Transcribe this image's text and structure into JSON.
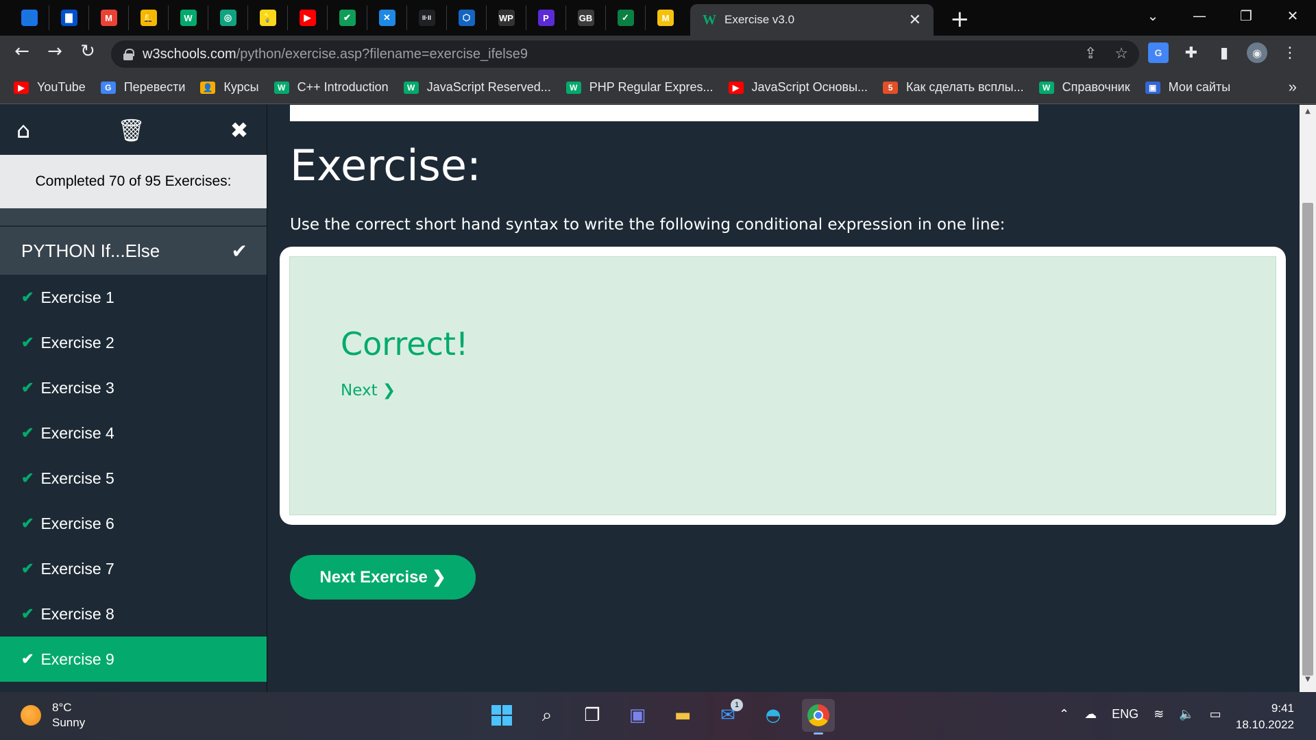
{
  "browser": {
    "pinned_tabs": [
      {
        "icon": "contacts-icon",
        "color": "#1a73e8",
        "glyph": "👤"
      },
      {
        "icon": "trello-icon",
        "color": "#0052cc",
        "glyph": "▇"
      },
      {
        "icon": "gmail-icon",
        "color": "#ea4335",
        "glyph": "M"
      },
      {
        "icon": "bell-icon",
        "color": "#f5b700",
        "glyph": "🔔"
      },
      {
        "icon": "w3schools-icon",
        "color": "#04aa6d",
        "glyph": "W"
      },
      {
        "icon": "chatgpt-icon",
        "color": "#10a37f",
        "glyph": "◎"
      },
      {
        "icon": "lightbulb-icon",
        "color": "#f9d71c",
        "glyph": "💡"
      },
      {
        "icon": "youtube-icon",
        "color": "#ff0000",
        "glyph": "▶"
      },
      {
        "icon": "checkmark-app-icon",
        "color": "#0f9d58",
        "glyph": "✔"
      },
      {
        "icon": "xcode-icon",
        "color": "#1e88e5",
        "glyph": "✕"
      },
      {
        "icon": "dots-icon",
        "color": "#202124",
        "glyph": "II·II"
      },
      {
        "icon": "settings-hex-icon",
        "color": "#1565c0",
        "glyph": "⬡"
      },
      {
        "icon": "wp-icon",
        "color": "#333333",
        "glyph": "WP"
      },
      {
        "icon": "p-icon",
        "color": "#5b2bd6",
        "glyph": "P"
      },
      {
        "icon": "gb-icon",
        "color": "#3c3c3c",
        "glyph": "GB"
      },
      {
        "icon": "chart-app-icon",
        "color": "#0b8043",
        "glyph": "✓"
      },
      {
        "icon": "m-icon",
        "color": "#f4c20d",
        "glyph": "M"
      }
    ],
    "active_tab": {
      "title": "Exercise v3.0",
      "favicon": "w3schools-icon"
    },
    "url": {
      "domain": "w3schools.com",
      "path": "/python/exercise.asp?filename=exercise_ifelse9"
    },
    "bookmarks": [
      {
        "label": "YouTube",
        "icon": "youtube-icon",
        "color": "#ff0000",
        "glyph": "▶"
      },
      {
        "label": "Перевести",
        "icon": "translate-icon",
        "color": "#4285f4",
        "glyph": "G"
      },
      {
        "label": "Курсы",
        "icon": "classroom-icon",
        "color": "#f9ab00",
        "glyph": "👤"
      },
      {
        "label": "C++ Introduction",
        "icon": "w3schools-icon",
        "color": "#04aa6d",
        "glyph": "W"
      },
      {
        "label": "JavaScript Reserved...",
        "icon": "w3schools-icon",
        "color": "#04aa6d",
        "glyph": "W"
      },
      {
        "label": "PHP Regular Expres...",
        "icon": "w3schools-icon",
        "color": "#04aa6d",
        "glyph": "W"
      },
      {
        "label": "JavaScript Основы...",
        "icon": "youtube-icon",
        "color": "#ff0000",
        "glyph": "▶"
      },
      {
        "label": "Как сделать всплы...",
        "icon": "html5-icon",
        "color": "#e34f26",
        "glyph": "5"
      },
      {
        "label": "Справочник",
        "icon": "w3schools-icon",
        "color": "#04aa6d",
        "glyph": "W"
      },
      {
        "label": "Мои сайты",
        "icon": "sites-icon",
        "color": "#3367d6",
        "glyph": "▣"
      }
    ]
  },
  "sidebar": {
    "progress_text": "Completed 70 of 95 Exercises:",
    "section_title": "PYTHON If...Else",
    "items": [
      {
        "label": "Exercise 1",
        "active": false
      },
      {
        "label": "Exercise 2",
        "active": false
      },
      {
        "label": "Exercise 3",
        "active": false
      },
      {
        "label": "Exercise 4",
        "active": false
      },
      {
        "label": "Exercise 5",
        "active": false
      },
      {
        "label": "Exercise 6",
        "active": false
      },
      {
        "label": "Exercise 7",
        "active": false
      },
      {
        "label": "Exercise 8",
        "active": false
      },
      {
        "label": "Exercise 9",
        "active": true
      }
    ]
  },
  "main": {
    "heading": "Exercise:",
    "instruction": "Use the correct short hand syntax to write the following conditional expression in one line:",
    "result": "Correct!",
    "next_link": "Next ❯",
    "next_button": "Next Exercise ❯"
  },
  "taskbar": {
    "weather": {
      "temp": "8°C",
      "condition": "Sunny"
    },
    "apps": [
      "windows-start-icon",
      "search-icon",
      "task-view-icon",
      "teams-chat-icon",
      "file-explorer-icon",
      "mail-icon",
      "edge-icon",
      "chrome-icon"
    ],
    "mail_badge": "1",
    "lang": "ENG",
    "time": "9:41",
    "date": "18.10.2022"
  },
  "colors": {
    "brand": "#04aa6d",
    "sidebar_bg": "#1d2a35",
    "section_bg": "#38444d",
    "success_bg": "#d9eee1"
  }
}
